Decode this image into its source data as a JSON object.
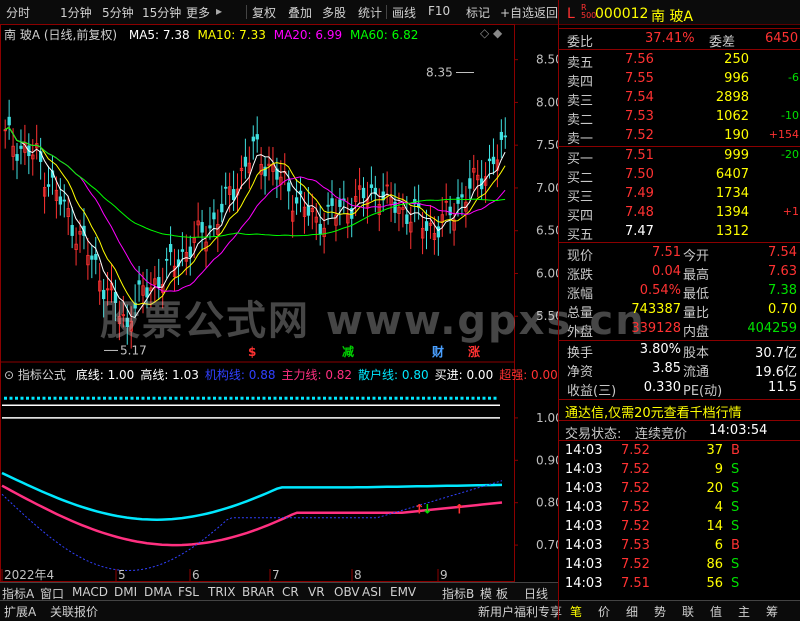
{
  "toolbar": {
    "items": [
      "分时",
      "1分钟",
      "5分钟",
      "15分钟",
      "更多",
      "复权",
      "叠加",
      "多股",
      "统计",
      "画线",
      "F10",
      "标记",
      "+自选",
      "返回"
    ],
    "more_arrow": "▸"
  },
  "chart_header": {
    "title": "南 玻A (日线,前复权)",
    "ma5": "MA5: 7.38",
    "ma10": "MA10: 7.33",
    "ma20": "MA20: 6.99",
    "ma60": "MA60: 6.82",
    "colors": {
      "ma5": "#ffffff",
      "ma10": "#ffff00",
      "ma20": "#ff00ff",
      "ma60": "#00ff00"
    }
  },
  "chart_data": {
    "type": "candlestick",
    "price_axis": [
      8.5,
      8.0,
      7.5,
      7.0,
      6.5,
      6.0,
      5.5
    ],
    "ylim": [
      5.17,
      8.6
    ],
    "annotation_high": "8.35",
    "annotation_low": "5.17",
    "signal_marks": [
      {
        "label": "$",
        "color": "#ff3232"
      },
      {
        "label": "减",
        "color": "#00d000"
      },
      {
        "label": "财",
        "color": "#4aa0ff"
      },
      {
        "label": "涨",
        "color": "#ff3232"
      }
    ],
    "x_labels": [
      "2022年4",
      "5",
      "6",
      "7",
      "8",
      "9"
    ],
    "period": "日线"
  },
  "indicator": {
    "title": "指标公式",
    "values": [
      {
        "label": "底线: 1.00",
        "color": "#ffffff"
      },
      {
        "label": "高线: 1.03",
        "color": "#ffffff"
      },
      {
        "label": "机构线: 0.88",
        "color": "#3040ff"
      },
      {
        "label": "主力线: 0.82",
        "color": "#ff3080"
      },
      {
        "label": "散户线: 0.80",
        "color": "#00e8ff"
      },
      {
        "label": "买进: 0.00",
        "color": "#ffffff"
      },
      {
        "label": "超强: 0.00",
        "color": "#ff3232"
      }
    ],
    "axis": [
      "1.00",
      "0.90",
      "0.80",
      "0.70"
    ]
  },
  "bottom_tabs": [
    "指标A",
    "窗口",
    "MACD",
    "DMI",
    "DMA",
    "FSL",
    "TRIX",
    "BRAR",
    "CR",
    "VR",
    "OBV",
    "ASI",
    "EMV",
    "指标B",
    "模",
    "板"
  ],
  "status_bar": {
    "left": [
      "扩展A",
      "关联报价"
    ],
    "right_msg": "新用户福利专享",
    "right_tabs": [
      "笔",
      "价",
      "细",
      "势",
      "联",
      "值",
      "主",
      "筹"
    ]
  },
  "quote": {
    "market_flag": "L",
    "flag_sub": "R 500",
    "code": "000012",
    "name": "南 玻A",
    "weibi_label": "委比",
    "weibi": "37.41%",
    "weicha_label": "委差",
    "weicha": "6450",
    "asks": [
      {
        "label": "卖五",
        "price": "7.56",
        "vol": "250",
        "chg": ""
      },
      {
        "label": "卖四",
        "price": "7.55",
        "vol": "996",
        "chg": "-6"
      },
      {
        "label": "卖三",
        "price": "7.54",
        "vol": "2898",
        "chg": ""
      },
      {
        "label": "卖二",
        "price": "7.53",
        "vol": "1062",
        "chg": "-10"
      },
      {
        "label": "卖一",
        "price": "7.52",
        "vol": "190",
        "chg": "+154"
      }
    ],
    "bids": [
      {
        "label": "买一",
        "price": "7.51",
        "vol": "999",
        "chg": "-20"
      },
      {
        "label": "买二",
        "price": "7.50",
        "vol": "6407",
        "chg": ""
      },
      {
        "label": "买三",
        "price": "7.49",
        "vol": "1734",
        "chg": ""
      },
      {
        "label": "买四",
        "price": "7.48",
        "vol": "1394",
        "chg": "+1"
      },
      {
        "label": "买五",
        "price": "7.47",
        "vol": "1312",
        "chg": ""
      }
    ],
    "stats": [
      {
        "l1": "现价",
        "v1": "7.51",
        "c1": "red",
        "l2": "今开",
        "v2": "7.54",
        "c2": "red"
      },
      {
        "l1": "涨跌",
        "v1": "0.04",
        "c1": "red",
        "l2": "最高",
        "v2": "7.63",
        "c2": "red"
      },
      {
        "l1": "涨幅",
        "v1": "0.54%",
        "c1": "red",
        "l2": "最低",
        "v2": "7.38",
        "c2": "grn"
      },
      {
        "l1": "总量",
        "v1": "743387",
        "c1": "yel",
        "l2": "量比",
        "v2": "0.70",
        "c2": "yel"
      },
      {
        "l1": "外盘",
        "v1": "339128",
        "c1": "red",
        "l2": "内盘",
        "v2": "404259",
        "c2": "grn"
      }
    ],
    "stats2": [
      {
        "l1": "换手",
        "v1": "3.80%",
        "l2": "股本",
        "v2": "30.7亿"
      },
      {
        "l1": "净资",
        "v1": "3.85",
        "l2": "流通",
        "v2": "19.6亿"
      },
      {
        "l1": "收益(三)",
        "v1": "0.330",
        "l2": "PE(动)",
        "v2": "11.5"
      }
    ],
    "promo": "通达信,仅需20元查看千档行情",
    "trade_status_label": "交易状态:",
    "trade_status": "连续竞价",
    "trade_time": "14:03:54",
    "ticks": [
      {
        "t": "14:03",
        "p": "7.52",
        "v": "37",
        "s": "B"
      },
      {
        "t": "14:03",
        "p": "7.52",
        "v": "9",
        "s": "S"
      },
      {
        "t": "14:03",
        "p": "7.52",
        "v": "20",
        "s": "S"
      },
      {
        "t": "14:03",
        "p": "7.52",
        "v": "4",
        "s": "S"
      },
      {
        "t": "14:03",
        "p": "7.52",
        "v": "14",
        "s": "S"
      },
      {
        "t": "14:03",
        "p": "7.53",
        "v": "6",
        "s": "B"
      },
      {
        "t": "14:03",
        "p": "7.52",
        "v": "86",
        "s": "S"
      },
      {
        "t": "14:03",
        "p": "7.51",
        "v": "56",
        "s": "S"
      }
    ]
  },
  "watermark": "股票公式网  www.gpxs.cn"
}
